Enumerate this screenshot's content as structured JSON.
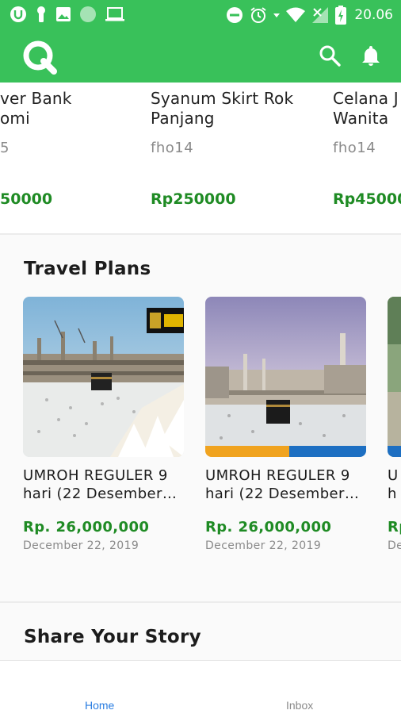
{
  "status_bar": {
    "time": "20.06",
    "icons": [
      "u-app-icon",
      "keyhole-icon",
      "image-icon",
      "circle-icon",
      "laptop-icon",
      "dnd-icon",
      "alarm-icon",
      "wifi-icon",
      "signal-icon",
      "battery-icon"
    ]
  },
  "app_bar": {
    "logo_icon": "q-logo-icon",
    "search_icon": "search-icon",
    "notification_icon": "bell-icon",
    "color": "#39c15a"
  },
  "products": [
    {
      "name_line1": "ver Bank",
      "name_line2": "omi",
      "seller": "5",
      "price": "50000"
    },
    {
      "name_line1": "Syanum Skirt Rok",
      "name_line2": "Panjang",
      "seller": "fho14",
      "price": "Rp250000"
    },
    {
      "name_line1": "Celana J",
      "name_line2": "Wanita",
      "seller": "fho14",
      "price": "Rp45000"
    }
  ],
  "travel": {
    "title": "Travel Plans",
    "items": [
      {
        "name_line1": "UMROH REGULER 9",
        "name_line2": "hari (22 Desember…",
        "price": "Rp. 26,000,000",
        "date": "December 22, 2019"
      },
      {
        "name_line1": "UMROH REGULER 9",
        "name_line2": "hari (22 Desember…",
        "price": "Rp. 26,000,000",
        "date": "December 22, 2019"
      },
      {
        "name_line1": "U",
        "name_line2": "h",
        "price": "Rp",
        "date": "De"
      }
    ]
  },
  "story": {
    "title": "Share Your Story"
  },
  "bottom_nav": {
    "home": "Home",
    "inbox": "Inbox",
    "active_color": "#2a7de1"
  },
  "colors": {
    "brand": "#39c15a",
    "price": "#1f8b24"
  }
}
